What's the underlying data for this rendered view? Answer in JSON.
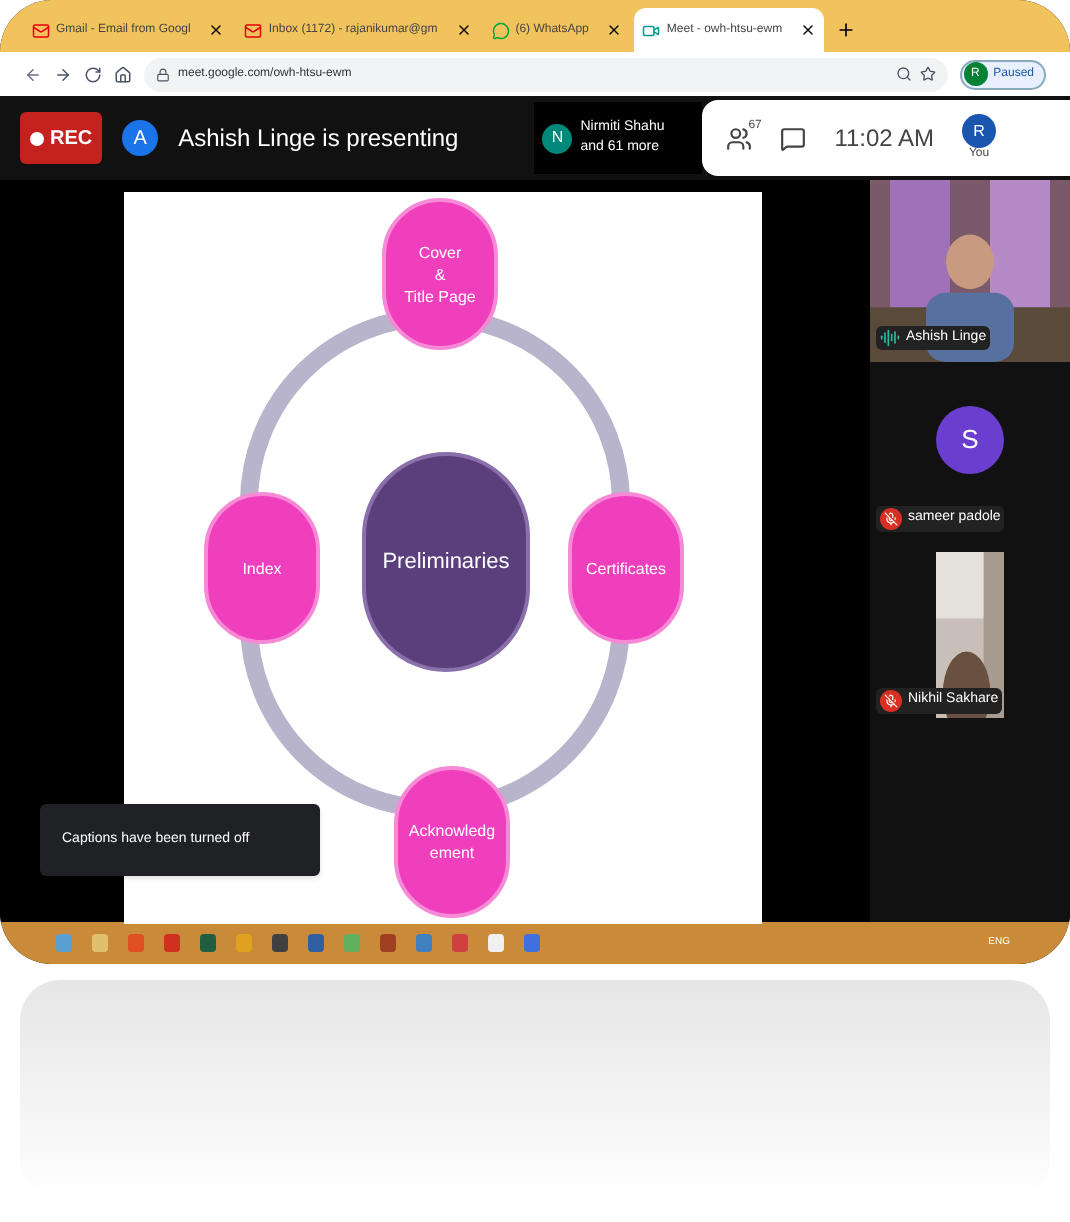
{
  "browser": {
    "tabs": [
      {
        "title": "Gmail - Email from Googl",
        "selected": false
      },
      {
        "title": "Inbox (1172) - rajanikumar@gm",
        "selected": false
      },
      {
        "title": "(6) WhatsApp",
        "selected": false
      },
      {
        "title": "Meet - owh-htsu-ewm",
        "selected": true
      }
    ],
    "url": "meet.google.com/owh-htsu-ewm",
    "profile": {
      "initial": "R",
      "status": "Paused"
    }
  },
  "meet_header": {
    "rec": "REC",
    "presenter": {
      "initial": "A",
      "text": "Ashish Linge is presenting"
    },
    "others": {
      "initial": "N",
      "line1": "Nirmiti Shahu",
      "line2": "and 61 more"
    },
    "people_count": "67",
    "time": "11:02 AM",
    "you": {
      "initial": "R",
      "label": "You"
    }
  },
  "slide": {
    "center": "Preliminaries",
    "nodes": [
      {
        "text": "Cover\n&\nTitle Page"
      },
      {
        "text": "Certificates"
      },
      {
        "text": "Acknowledg\nement"
      },
      {
        "text": "Index"
      }
    ]
  },
  "toast": "Captions have been turned off",
  "participants": [
    {
      "name": "Ashish Linge",
      "kind": "video",
      "muted": false
    },
    {
      "name": "sameer padole",
      "kind": "avatar",
      "initial": "S",
      "muted": true
    },
    {
      "name": "Nikhil Sakhare",
      "kind": "video",
      "muted": true
    }
  ],
  "taskbar": {
    "language": "ENG"
  }
}
